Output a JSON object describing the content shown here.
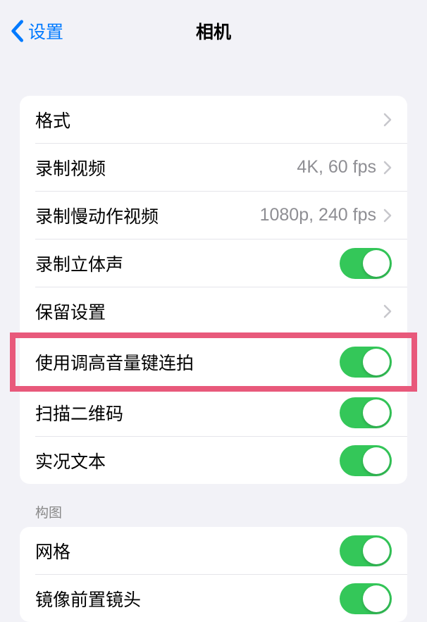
{
  "nav": {
    "back_label": "设置",
    "title": "相机"
  },
  "group1": {
    "rows": [
      {
        "label": "格式",
        "type": "nav"
      },
      {
        "label": "录制视频",
        "value": "4K, 60 fps",
        "type": "nav"
      },
      {
        "label": "录制慢动作视频",
        "value": "1080p, 240 fps",
        "type": "nav"
      },
      {
        "label": "录制立体声",
        "type": "toggle",
        "on": true
      },
      {
        "label": "保留设置",
        "type": "nav"
      },
      {
        "label": "使用调高音量键连拍",
        "type": "toggle",
        "on": true,
        "highlighted": true
      },
      {
        "label": "扫描二维码",
        "type": "toggle",
        "on": true
      },
      {
        "label": "实况文本",
        "type": "toggle",
        "on": true
      }
    ]
  },
  "group2": {
    "header": "构图",
    "rows": [
      {
        "label": "网格",
        "type": "toggle",
        "on": true
      },
      {
        "label": "镜像前置镜头",
        "type": "toggle",
        "on": true
      }
    ]
  },
  "colors": {
    "accent": "#007aff",
    "toggle_on": "#34c759",
    "highlight": "#e8597b"
  }
}
